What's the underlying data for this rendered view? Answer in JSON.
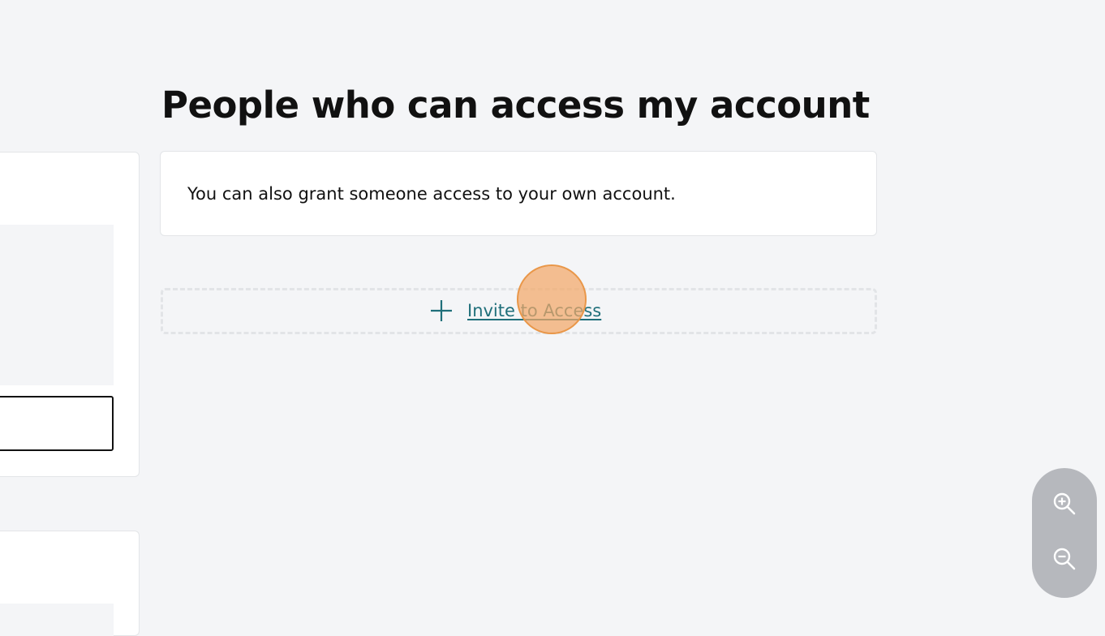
{
  "section": {
    "title": "People who can access my account",
    "info_text": "You can also grant someone access to your own account.",
    "invite_label": "Invite to Access"
  },
  "icons": {
    "invite": "plus-icon",
    "zoom_in": "zoom-in-icon",
    "zoom_out": "zoom-out-icon"
  },
  "colors": {
    "page_background": "#f4f5f7",
    "link": "#1f6f7a",
    "click_marker": "#f3a768",
    "zoom_control": "#b6b8bd"
  }
}
